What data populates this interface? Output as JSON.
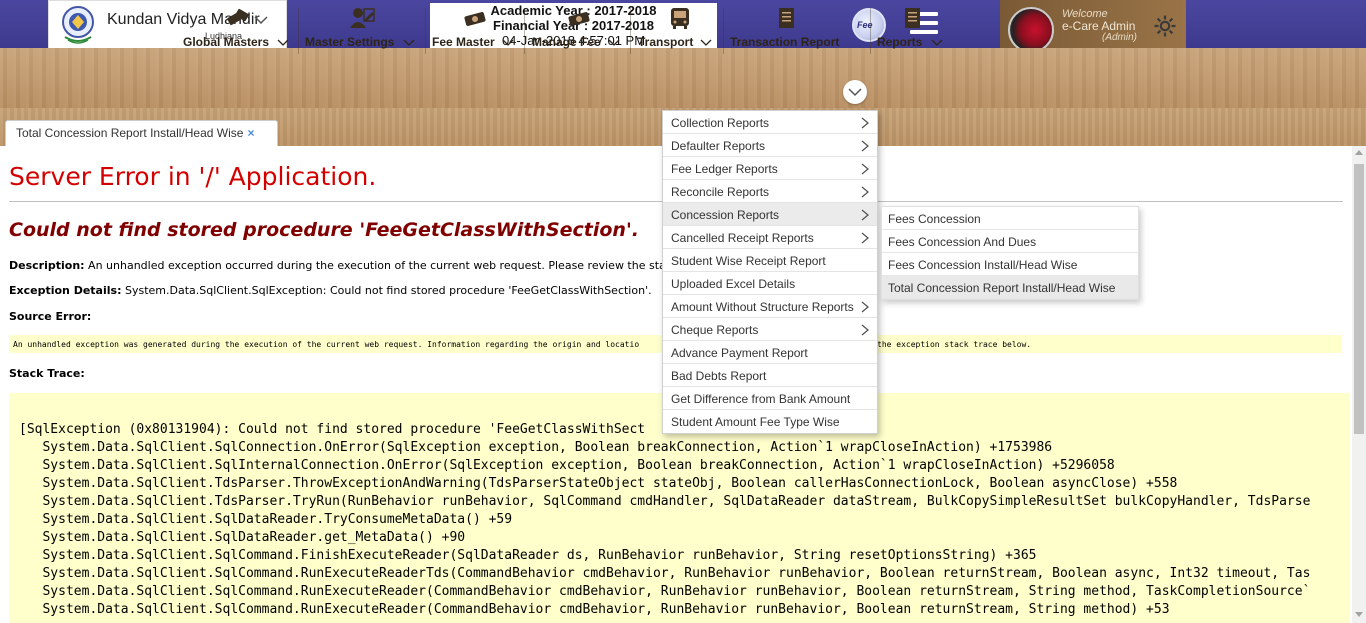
{
  "header": {
    "school_name": "Kundan Vidya Mandir",
    "school_city": "Ludhiana",
    "academic_year": "Academic Year : 2017-2018",
    "financial_year": "Financial Year : 2017-2018",
    "datetime": "04-Jan-2018 4:57:01 PM",
    "fee_logo_text": "Fee",
    "welcome": "Welcome",
    "user_name": "e-Care Admin",
    "user_role": "(Admin)"
  },
  "nav": {
    "items": [
      {
        "label": "Global Masters",
        "icon": "masters-icon"
      },
      {
        "label": "Master Settings",
        "icon": "settings-user-icon"
      },
      {
        "label": "Fee Master",
        "icon": "fee-master-icon"
      },
      {
        "label": "Manage Fee",
        "icon": "manage-fee-icon"
      },
      {
        "label": "Transport",
        "icon": "bus-icon"
      },
      {
        "label": "Transaction Report",
        "icon": "report-icon"
      },
      {
        "label": "Reports",
        "icon": "reports-icon"
      }
    ]
  },
  "tab": {
    "label": "Total Concession Report Install/Head Wise",
    "close": "×"
  },
  "error": {
    "title": "Server Error in '/' Application.",
    "subtitle": "Could not find stored procedure 'FeeGetClassWithSection'.",
    "description_label": "Description:",
    "description_text": " An unhandled exception occurred during the execution of the current web request. Please review the stack trace for",
    "description_tail": " the exception stack trace below.",
    "exception_label": "Exception Details:",
    "exception_text": " System.Data.SqlClient.SqlException: Could not find stored procedure 'FeeGetClassWithSection'.",
    "source_label": "Source Error:",
    "source_text": "An unhandled exception was generated during the execution of the current web request. Information regarding the origin and locatio",
    "source_tail": "the exception stack trace below.",
    "stack_label": "Stack Trace:",
    "stack_lines": [
      "[SqlException (0x80131904): Could not find stored procedure 'FeeGetClassWithSect",
      "   System.Data.SqlClient.SqlConnection.OnError(SqlException exception, Boolean breakConnection, Action`1 wrapCloseInAction) +1753986",
      "   System.Data.SqlClient.SqlInternalConnection.OnError(SqlException exception, Boolean breakConnection, Action`1 wrapCloseInAction) +5296058",
      "   System.Data.SqlClient.TdsParser.ThrowExceptionAndWarning(TdsParserStateObject stateObj, Boolean callerHasConnectionLock, Boolean asyncClose) +558",
      "   System.Data.SqlClient.TdsParser.TryRun(RunBehavior runBehavior, SqlCommand cmdHandler, SqlDataReader dataStream, BulkCopySimpleResultSet bulkCopyHandler, TdsParse",
      "   System.Data.SqlClient.SqlDataReader.TryConsumeMetaData() +59",
      "   System.Data.SqlClient.SqlDataReader.get_MetaData() +90",
      "   System.Data.SqlClient.SqlCommand.FinishExecuteReader(SqlDataReader ds, RunBehavior runBehavior, String resetOptionsString) +365",
      "   System.Data.SqlClient.SqlCommand.RunExecuteReaderTds(CommandBehavior cmdBehavior, RunBehavior runBehavior, Boolean returnStream, Boolean async, Int32 timeout, Tas",
      "   System.Data.SqlClient.SqlCommand.RunExecuteReader(CommandBehavior cmdBehavior, RunBehavior runBehavior, Boolean returnStream, String method, TaskCompletionSource`",
      "   System.Data.SqlClient.SqlCommand.RunExecuteReader(CommandBehavior cmdBehavior, RunBehavior runBehavior, Boolean returnStream, String method) +53"
    ]
  },
  "menu": {
    "items": [
      {
        "label": "Collection Reports",
        "has_sub": true
      },
      {
        "label": "Defaulter Reports",
        "has_sub": true
      },
      {
        "label": "Fee Ledger Reports",
        "has_sub": true
      },
      {
        "label": "Reconcile Reports",
        "has_sub": true
      },
      {
        "label": "Concession Reports",
        "has_sub": true
      },
      {
        "label": "Cancelled Receipt Reports",
        "has_sub": true
      },
      {
        "label": "Student Wise Receipt Report",
        "has_sub": false
      },
      {
        "label": "Uploaded Excel Details",
        "has_sub": false
      },
      {
        "label": "Amount Without Structure Reports",
        "has_sub": true
      },
      {
        "label": "Cheque Reports",
        "has_sub": true
      },
      {
        "label": "Advance Payment Report",
        "has_sub": false
      },
      {
        "label": "Bad Debts Report",
        "has_sub": false
      },
      {
        "label": "Get Difference from Bank Amount",
        "has_sub": false
      },
      {
        "label": "Student Amount Fee Type Wise",
        "has_sub": false
      }
    ],
    "active_index": 4
  },
  "submenu": {
    "items": [
      {
        "label": "Fees Concession"
      },
      {
        "label": "Fees Concession And Dues"
      },
      {
        "label": "Fees Concession Install/Head Wise"
      },
      {
        "label": "Total Concession Report Install/Head Wise"
      }
    ],
    "active_index": 3
  },
  "colors": {
    "topbar": "#3d3a8e",
    "wood": "#c09a6c",
    "error_red": "#d40000",
    "error_maroon": "#800000",
    "code_bg": "#ffffcc"
  }
}
